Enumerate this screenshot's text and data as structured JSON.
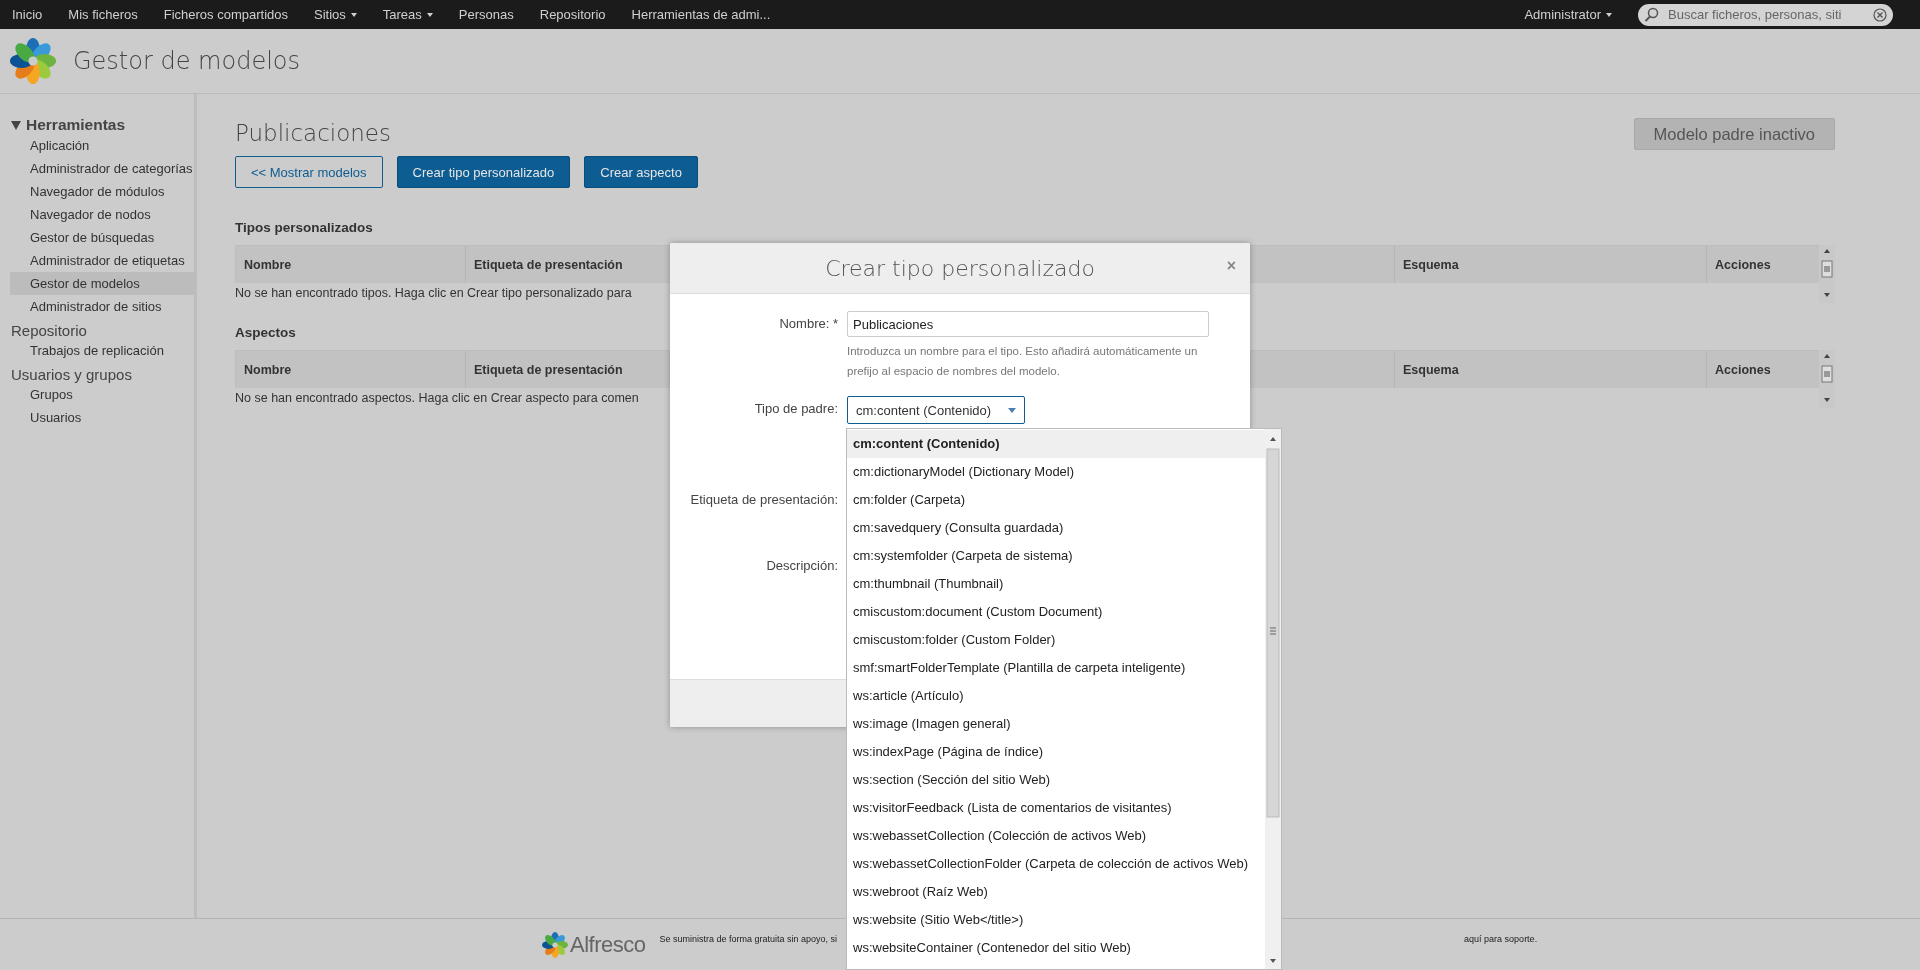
{
  "top_nav": {
    "items": [
      {
        "label": "Inicio",
        "dropdown": false
      },
      {
        "label": "Mis ficheros",
        "dropdown": false
      },
      {
        "label": "Ficheros compartidos",
        "dropdown": false
      },
      {
        "label": "Sitios",
        "dropdown": true
      },
      {
        "label": "Tareas",
        "dropdown": true
      },
      {
        "label": "Personas",
        "dropdown": false
      },
      {
        "label": "Repositorio",
        "dropdown": false
      },
      {
        "label": "Herramientas de admi...",
        "dropdown": false
      }
    ],
    "user": {
      "label": "Administrator",
      "dropdown": true
    },
    "search": {
      "placeholder": "Buscar ficheros, personas, siti"
    }
  },
  "header": {
    "title": "Gestor de modelos"
  },
  "sidebar": {
    "sections": [
      {
        "label": "Herramientas",
        "expanded": true,
        "items": [
          {
            "label": "Aplicación",
            "selected": false
          },
          {
            "label": "Administrador de categorías",
            "selected": false
          },
          {
            "label": "Navegador de módulos",
            "selected": false
          },
          {
            "label": "Navegador de nodos",
            "selected": false
          },
          {
            "label": "Gestor de búsquedas",
            "selected": false
          },
          {
            "label": "Administrador de etiquetas",
            "selected": false
          },
          {
            "label": "Gestor de modelos",
            "selected": true
          },
          {
            "label": "Administrador de sitios",
            "selected": false
          }
        ]
      },
      {
        "label": "Repositorio",
        "items": [
          {
            "label": "Trabajos de replicación",
            "selected": false
          }
        ]
      },
      {
        "label": "Usuarios y grupos",
        "items": [
          {
            "label": "Grupos",
            "selected": false
          },
          {
            "label": "Usuarios",
            "selected": false
          }
        ]
      }
    ]
  },
  "main": {
    "title": "Publicaciones",
    "buttons": [
      {
        "label": "<< Mostrar modelos",
        "kind": "outline"
      },
      {
        "label": "Crear tipo personalizado",
        "kind": "primary"
      },
      {
        "label": "Crear aspecto",
        "kind": "primary"
      }
    ],
    "status_button": {
      "label": "Modelo padre inactivo",
      "disabled": true
    },
    "tables": [
      {
        "title": "Tipos personalizados",
        "columns": [
          "Nombre",
          "Etiqueta de presentación",
          "Esquema",
          "Acciones"
        ],
        "empty_text": "No se han encontrado tipos. Haga clic en Crear tipo personalizado para"
      },
      {
        "title": "Aspectos",
        "columns": [
          "Nombre",
          "Etiqueta de presentación",
          "Esquema",
          "Acciones"
        ],
        "empty_text": "No se han encontrado aspectos. Haga clic en Crear aspecto para comen"
      }
    ]
  },
  "dialog": {
    "title": "Crear tipo personalizado",
    "close": "×",
    "fields": [
      {
        "label": "Nombre: *",
        "kind": "text",
        "value": "Publicaciones",
        "help": "Introduzca un nombre para el tipo. Esto añadirá automáticamente un prefijo al espacio de nombres del modelo."
      },
      {
        "label": "Tipo de padre:",
        "kind": "select",
        "value": "cm:content (Contenido)"
      },
      {
        "label": "Etiqueta de presentación:",
        "kind": "covered"
      },
      {
        "label": "Descripción:",
        "kind": "covered"
      }
    ]
  },
  "dropdown_options": [
    {
      "label": "cm:content (Contenido)",
      "selected": true
    },
    {
      "label": "cm:dictionaryModel (Dictionary Model)",
      "selected": false
    },
    {
      "label": "cm:folder (Carpeta)",
      "selected": false
    },
    {
      "label": "cm:savedquery (Consulta guardada)",
      "selected": false
    },
    {
      "label": "cm:systemfolder (Carpeta de sistema)",
      "selected": false
    },
    {
      "label": "cm:thumbnail (Thumbnail)",
      "selected": false
    },
    {
      "label": "cmiscustom:document (Custom Document)",
      "selected": false
    },
    {
      "label": "cmiscustom:folder (Custom Folder)",
      "selected": false
    },
    {
      "label": "smf:smartFolderTemplate (Plantilla de carpeta inteligente)",
      "selected": false
    },
    {
      "label": "ws:article (Artículo)",
      "selected": false
    },
    {
      "label": "ws:image (Imagen general)",
      "selected": false
    },
    {
      "label": "ws:indexPage (Página de índice)",
      "selected": false
    },
    {
      "label": "ws:section (Sección del sitio Web)",
      "selected": false
    },
    {
      "label": "ws:visitorFeedback (Lista de comentarios de visitantes)",
      "selected": false
    },
    {
      "label": "ws:webassetCollection (Colección de activos Web)",
      "selected": false
    },
    {
      "label": "ws:webassetCollectionFolder (Carpeta de colección de activos Web)",
      "selected": false
    },
    {
      "label": "ws:webroot (Raíz Web)",
      "selected": false
    },
    {
      "label": "ws:website (Sitio Web</title>)",
      "selected": false
    },
    {
      "label": "ws:websiteContainer (Contenedor del sitio Web)",
      "selected": false
    }
  ],
  "footer": {
    "logo_text": "Alfresco",
    "text_left": "Se suministra de forma gratuita sin apoyo, si",
    "text_right": "aquí para soporte."
  }
}
